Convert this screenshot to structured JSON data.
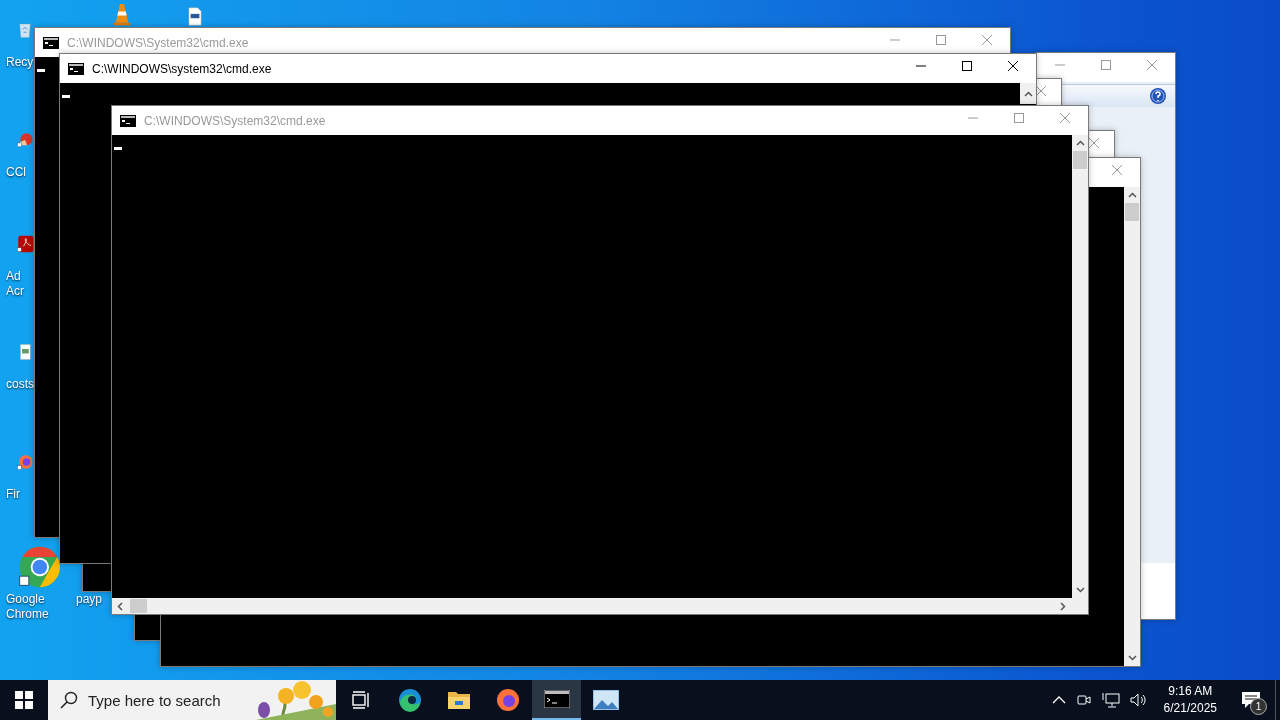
{
  "desktop_icons": [
    {
      "kind": "recycle-bin",
      "label": "Recy"
    },
    {
      "kind": "cone"
    },
    {
      "kind": "document"
    },
    {
      "kind": "ccleaner",
      "label": "CCl"
    },
    {
      "kind": "acrobat",
      "label": "Ad\nAcr"
    },
    {
      "kind": "image-file",
      "label": "costs"
    },
    {
      "kind": "firefox",
      "label": "Fir"
    },
    {
      "kind": "chrome",
      "label": "Google Chrome"
    },
    {
      "label": "payp"
    }
  ],
  "windows": [
    {
      "kind": "dialog",
      "active": false
    },
    {
      "kind": "console",
      "active": false
    },
    {
      "kind": "console",
      "active": false
    },
    {
      "kind": "console",
      "active": false
    },
    {
      "kind": "console",
      "title": "C:\\WINDOWS\\System32\\cmd.exe",
      "active": false
    },
    {
      "kind": "console",
      "title": "C:\\WINDOWS\\system32\\cmd.exe",
      "active": true
    },
    {
      "kind": "console",
      "title": "C:\\WINDOWS\\System32\\cmd.exe",
      "active": false
    }
  ],
  "taskbar": {
    "search": {
      "placeholder": "Type here to search"
    },
    "apps": [
      {
        "kind": "task-view",
        "selected": false
      },
      {
        "kind": "edge",
        "selected": false
      },
      {
        "kind": "folder",
        "selected": false
      },
      {
        "kind": "firefox",
        "selected": false
      },
      {
        "kind": "console",
        "selected": true
      },
      {
        "kind": "picture-app",
        "selected": false
      }
    ],
    "clock": {
      "time": "9:16 AM",
      "date": "6/21/2025"
    },
    "notifications": {
      "count": "1"
    }
  }
}
